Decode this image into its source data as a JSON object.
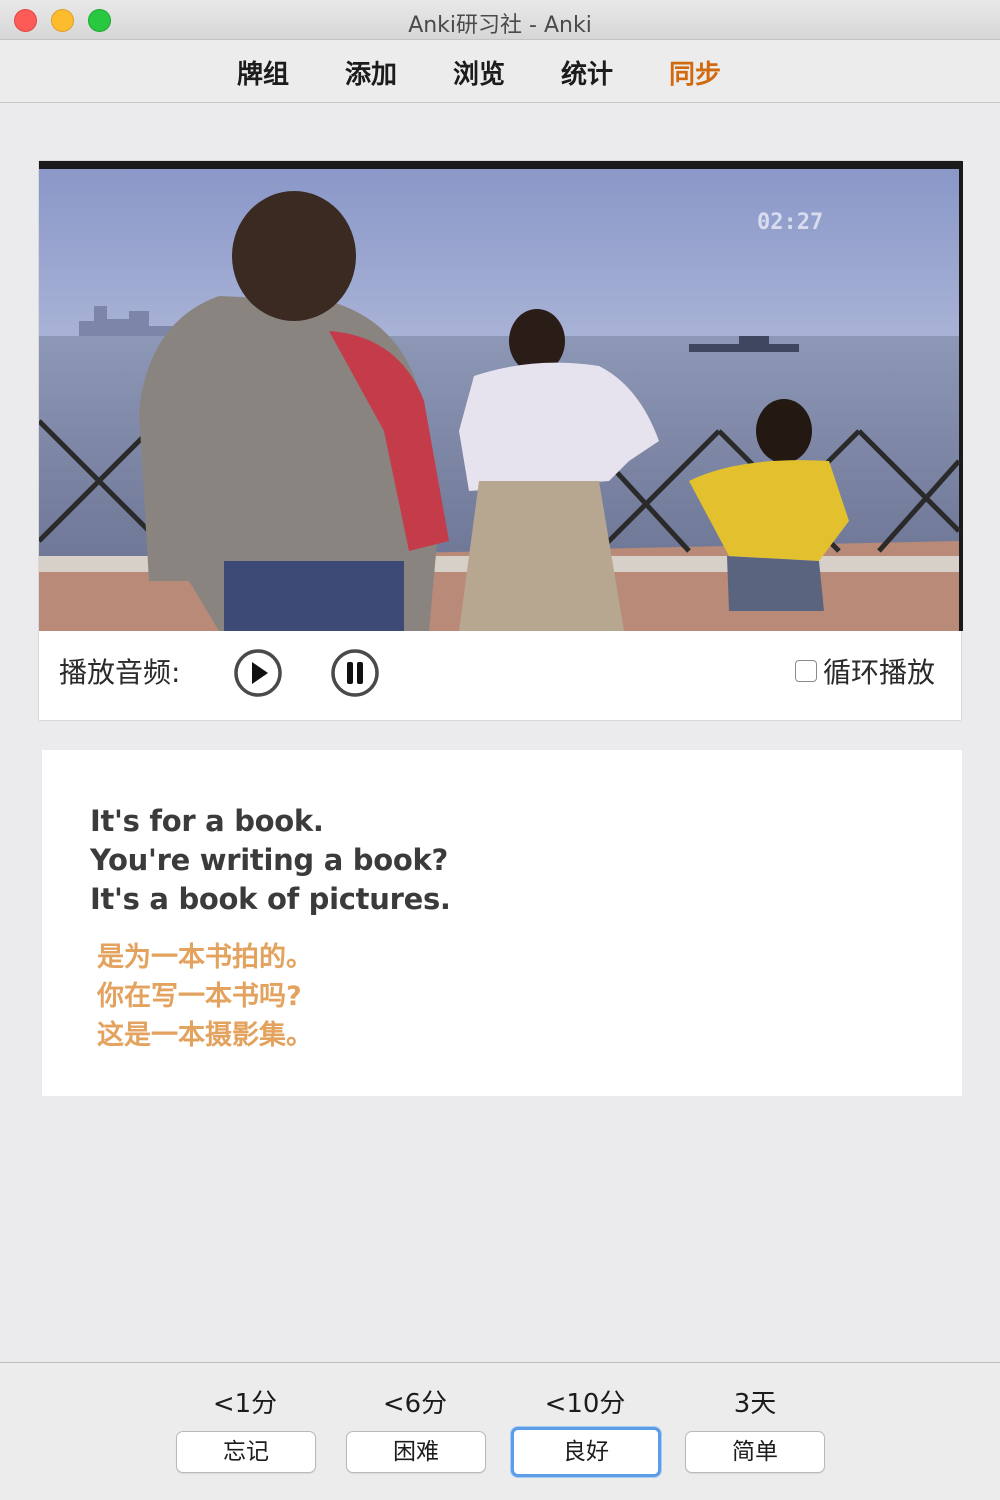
{
  "window": {
    "title": "Anki研习社 - Anki"
  },
  "toolbar": {
    "decks": "牌组",
    "add": "添加",
    "browse": "浏览",
    "stats": "统计",
    "sync": "同步",
    "sync_color": "#d16a0e"
  },
  "video": {
    "timestamp": "02:27"
  },
  "player": {
    "audio_label": "播放音频:",
    "play_icon": "play-circle-icon",
    "pause_icon": "pause-circle-icon",
    "loop_label": "循环播放",
    "loop_checked": false
  },
  "card": {
    "english": [
      "It's for a book.",
      "You're writing a book?",
      "It's a book of pictures."
    ],
    "chinese": [
      "是为一本书拍的。",
      "你在写一本书吗?",
      "这是一本摄影集。"
    ],
    "chinese_color": "#e3a25e"
  },
  "answers": {
    "intervals": [
      "<1分",
      "<6分",
      "<10分",
      "3天"
    ],
    "buttons": [
      "忘记",
      "困难",
      "良好",
      "简单"
    ],
    "focused_index": 2,
    "focus_color": "#5c9de9"
  }
}
